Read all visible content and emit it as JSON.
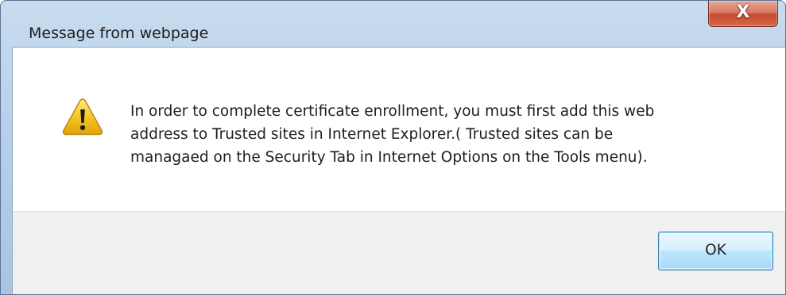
{
  "window": {
    "title": "Message from webpage"
  },
  "titlebar": {
    "close_glyph": "X"
  },
  "dialog": {
    "icon": "warning-icon",
    "message_lines": [
      "In order to complete certificate enrollment, you must first add this web",
      "address to Trusted sites in Internet Explorer.( Trusted sites can be",
      "managaed on the Security Tab in Internet Options on the Tools menu)."
    ],
    "ok_label": "OK"
  },
  "colors": {
    "frame": "#b8d0ea",
    "close_button": "#c54a30",
    "warning_fill": "#f2c319",
    "button_border": "#3c7fb1"
  }
}
